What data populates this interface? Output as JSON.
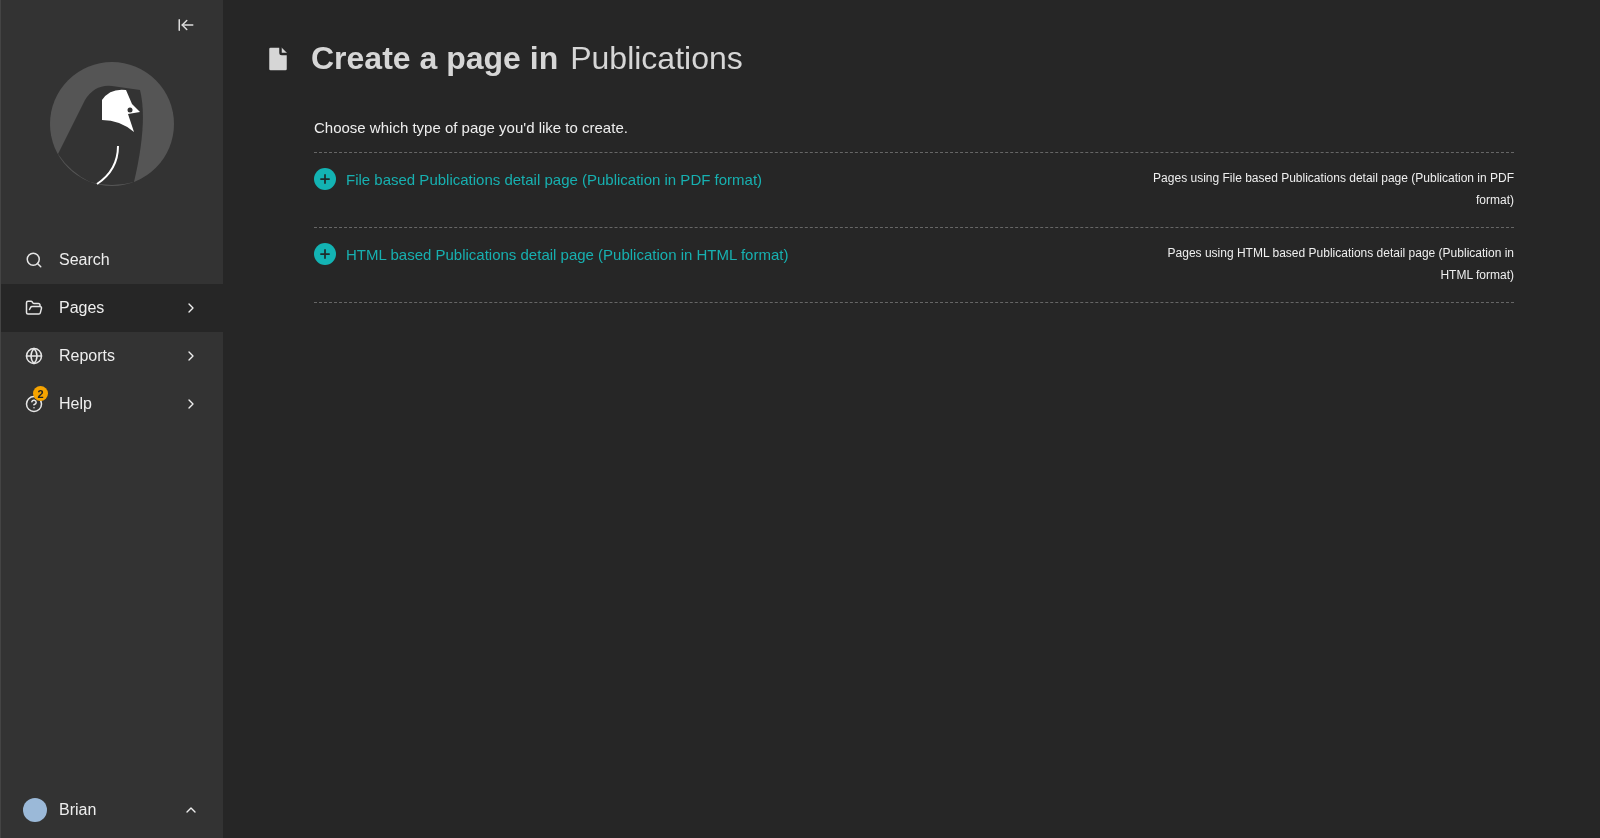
{
  "sidebar": {
    "items": [
      {
        "kind": "search",
        "label": "Search",
        "selected": false
      },
      {
        "kind": "menu",
        "label": "Pages",
        "selected": true
      },
      {
        "kind": "menu",
        "label": "Reports",
        "selected": false
      },
      {
        "kind": "menu",
        "label": "Help",
        "selected": false,
        "badge": "2"
      }
    ],
    "user": {
      "name": "Brian"
    }
  },
  "header": {
    "title": "Create a page in",
    "context": "Publications"
  },
  "intro": "Choose which type of page you'd like to create.",
  "page_types": [
    {
      "label": "File based Publications detail page (Publication in PDF format)",
      "usage": "Pages using File based Publications detail page (Publication in PDF format)"
    },
    {
      "label": "HTML based Publications detail page (Publication in HTML format)",
      "usage": "Pages using HTML based Publications detail page (Publication in HTML format)"
    }
  ]
}
